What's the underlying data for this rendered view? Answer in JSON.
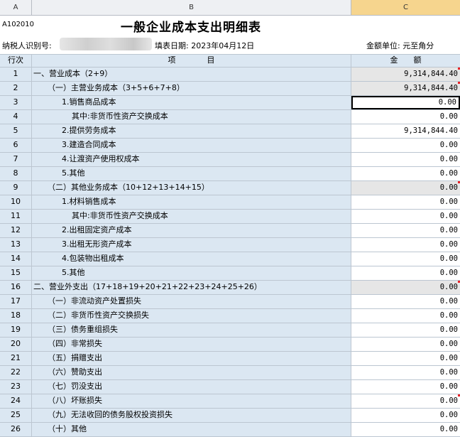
{
  "columns": {
    "a": "A",
    "b": "B",
    "c": "C"
  },
  "form_code": "A102010",
  "title": "一般企业成本支出明细表",
  "taxpayer_id_label": "纳税人识别号:",
  "fill_date": "填表日期: 2023年04月12日",
  "unit": "金额单位: 元至角分",
  "headers": {
    "num": "行次",
    "item": "项　　　　目",
    "amount": "金　　额"
  },
  "rows": [
    {
      "num": "1",
      "label": "一、营业成本（2+9）",
      "amount": "9,314,844.40",
      "type": "total",
      "level": 0,
      "marker": true
    },
    {
      "num": "2",
      "label": "（一）主营业务成本（3+5+6+7+8）",
      "amount": "9,314,844.40",
      "type": "total",
      "level": 1,
      "marker": true
    },
    {
      "num": "3",
      "label": "1.销售商品成本",
      "amount": "0.00",
      "type": "selected",
      "level": 2,
      "marker": false
    },
    {
      "num": "4",
      "label": "其中:非货币性资产交换成本",
      "amount": "0.00",
      "type": "editable",
      "level": 3,
      "marker": false
    },
    {
      "num": "5",
      "label": "2.提供劳务成本",
      "amount": "9,314,844.40",
      "type": "editable",
      "level": 2,
      "marker": false
    },
    {
      "num": "6",
      "label": "3.建造合同成本",
      "amount": "0.00",
      "type": "editable",
      "level": 2,
      "marker": false
    },
    {
      "num": "7",
      "label": "4.让渡资产使用权成本",
      "amount": "0.00",
      "type": "editable",
      "level": 2,
      "marker": false
    },
    {
      "num": "8",
      "label": "5.其他",
      "amount": "0.00",
      "type": "editable",
      "level": 2,
      "marker": false
    },
    {
      "num": "9",
      "label": "（二）其他业务成本（10+12+13+14+15）",
      "amount": "0.00",
      "type": "total",
      "level": 1,
      "marker": true
    },
    {
      "num": "10",
      "label": "1.材料销售成本",
      "amount": "0.00",
      "type": "editable",
      "level": 2,
      "marker": false
    },
    {
      "num": "11",
      "label": "其中:非货币性资产交换成本",
      "amount": "0.00",
      "type": "editable",
      "level": 3,
      "marker": false
    },
    {
      "num": "12",
      "label": "2.出租固定资产成本",
      "amount": "0.00",
      "type": "editable",
      "level": 2,
      "marker": false
    },
    {
      "num": "13",
      "label": "3.出租无形资产成本",
      "amount": "0.00",
      "type": "editable",
      "level": 2,
      "marker": false
    },
    {
      "num": "14",
      "label": "4.包装物出租成本",
      "amount": "0.00",
      "type": "editable",
      "level": 2,
      "marker": false
    },
    {
      "num": "15",
      "label": "5.其他",
      "amount": "0.00",
      "type": "editable",
      "level": 2,
      "marker": false
    },
    {
      "num": "16",
      "label": "二、营业外支出（17+18+19+20+21+22+23+24+25+26）",
      "amount": "0.00",
      "type": "total",
      "level": 0,
      "marker": true
    },
    {
      "num": "17",
      "label": "（一）非流动资产处置损失",
      "amount": "0.00",
      "type": "editable",
      "level": 1,
      "marker": false
    },
    {
      "num": "18",
      "label": "（二）非货币性资产交换损失",
      "amount": "0.00",
      "type": "editable",
      "level": 1,
      "marker": false
    },
    {
      "num": "19",
      "label": "（三）债务重组损失",
      "amount": "0.00",
      "type": "editable",
      "level": 1,
      "marker": false
    },
    {
      "num": "20",
      "label": "（四）非常损失",
      "amount": "0.00",
      "type": "editable",
      "level": 1,
      "marker": false
    },
    {
      "num": "21",
      "label": "（五）捐赠支出",
      "amount": "0.00",
      "type": "editable",
      "level": 1,
      "marker": false
    },
    {
      "num": "22",
      "label": "（六）赞助支出",
      "amount": "0.00",
      "type": "editable",
      "level": 1,
      "marker": false
    },
    {
      "num": "23",
      "label": "（七）罚没支出",
      "amount": "0.00",
      "type": "editable",
      "level": 1,
      "marker": false
    },
    {
      "num": "24",
      "label": "（八）坏账损失",
      "amount": "0.00",
      "type": "editable",
      "level": 1,
      "marker": true
    },
    {
      "num": "25",
      "label": "（九）无法收回的债务股权投资损失",
      "amount": "0.00",
      "type": "editable",
      "level": 1,
      "marker": false
    },
    {
      "num": "26",
      "label": "（十）其他",
      "amount": "0.00",
      "type": "editable",
      "level": 1,
      "marker": false
    }
  ],
  "colors": {
    "label_bg": "#dbe7f2",
    "total_bg": "#e6e6e6",
    "active_col": "#f6d58e",
    "marker": "#e8242a"
  }
}
